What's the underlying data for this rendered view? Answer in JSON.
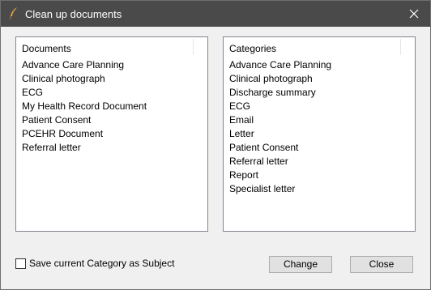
{
  "window": {
    "title": "Clean up documents",
    "icon": "quill-pen-icon",
    "close_icon": "close-icon"
  },
  "documents": {
    "header": "Documents",
    "items": [
      "Advance Care Planning",
      "Clinical photograph",
      "ECG",
      "My Health Record Document",
      "Patient Consent",
      "PCEHR Document",
      "Referral letter"
    ]
  },
  "categories": {
    "header": "Categories",
    "items": [
      "Advance Care Planning",
      "Clinical photograph",
      "Discharge summary",
      "ECG",
      "Email",
      "Letter",
      "Patient Consent",
      "Referral letter",
      "Report",
      "Specialist letter"
    ]
  },
  "options": {
    "save_category_label": "Save current Category as Subject",
    "save_category_checked": false
  },
  "buttons": {
    "change": "Change",
    "close": "Close"
  },
  "colors": {
    "titlebar": "#4a4a4a",
    "dialog_bg": "#f0f0f0",
    "list_border": "#828790",
    "button_bg": "#e1e1e1",
    "button_border": "#adadad"
  }
}
